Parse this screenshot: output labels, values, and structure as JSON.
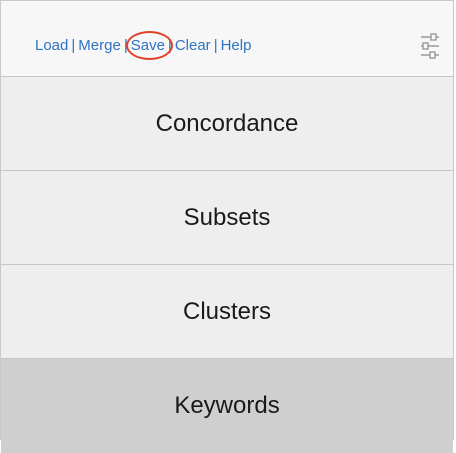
{
  "toolbar": {
    "links": [
      "Load",
      "Merge",
      "Save",
      "Clear",
      "Help"
    ],
    "separator": "|",
    "highlight_color": "#e0432c",
    "link_color": "#2f72c4",
    "settings_icon": "sliders-icon"
  },
  "menu": {
    "items": [
      {
        "label": "Concordance",
        "selected": false
      },
      {
        "label": "Subsets",
        "selected": false
      },
      {
        "label": "Clusters",
        "selected": false
      },
      {
        "label": "Keywords",
        "selected": true
      }
    ]
  }
}
